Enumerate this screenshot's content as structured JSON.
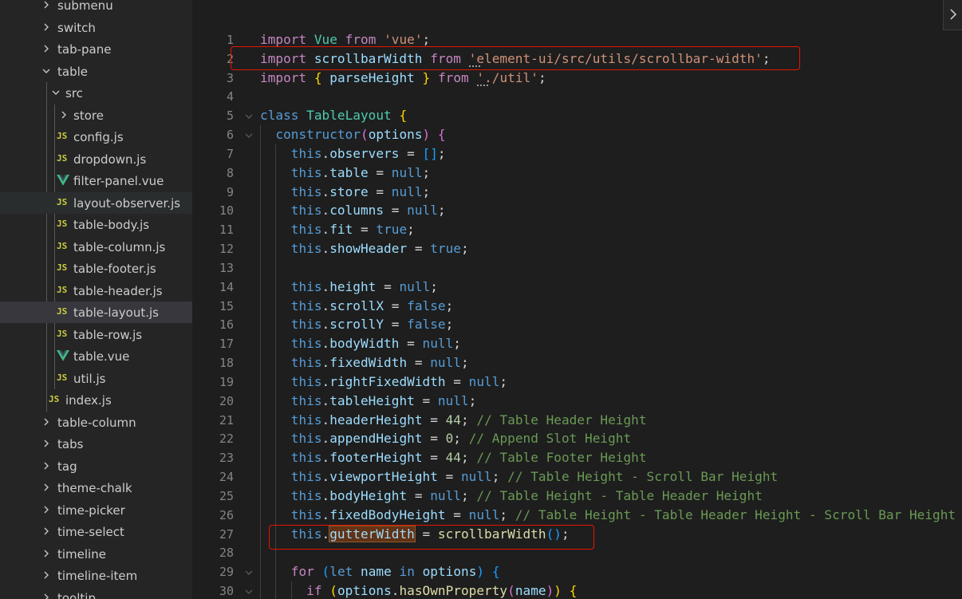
{
  "sidebar": {
    "items": [
      {
        "label": "submenu",
        "type": "folder",
        "open": false,
        "level": 1
      },
      {
        "label": "switch",
        "type": "folder",
        "open": false,
        "level": 1
      },
      {
        "label": "tab-pane",
        "type": "folder",
        "open": false,
        "level": 1
      },
      {
        "label": "table",
        "type": "folder",
        "open": true,
        "level": 1
      },
      {
        "label": "src",
        "type": "folder",
        "open": true,
        "level": 2
      },
      {
        "label": "store",
        "type": "folder",
        "open": false,
        "level": 3
      },
      {
        "label": "config.js",
        "type": "js",
        "level": 3
      },
      {
        "label": "dropdown.js",
        "type": "js",
        "level": 3
      },
      {
        "label": "filter-panel.vue",
        "type": "vue",
        "level": 3
      },
      {
        "label": "layout-observer.js",
        "type": "js",
        "level": 3,
        "state": "hover"
      },
      {
        "label": "table-body.js",
        "type": "js",
        "level": 3
      },
      {
        "label": "table-column.js",
        "type": "js",
        "level": 3
      },
      {
        "label": "table-footer.js",
        "type": "js",
        "level": 3
      },
      {
        "label": "table-header.js",
        "type": "js",
        "level": 3
      },
      {
        "label": "table-layout.js",
        "type": "js",
        "level": 3,
        "state": "selected"
      },
      {
        "label": "table-row.js",
        "type": "js",
        "level": 3
      },
      {
        "label": "table.vue",
        "type": "vue",
        "level": 3
      },
      {
        "label": "util.js",
        "type": "js",
        "level": 3
      },
      {
        "label": "index.js",
        "type": "js",
        "level": 2
      },
      {
        "label": "table-column",
        "type": "folder",
        "open": false,
        "level": 1
      },
      {
        "label": "tabs",
        "type": "folder",
        "open": false,
        "level": 1
      },
      {
        "label": "tag",
        "type": "folder",
        "open": false,
        "level": 1
      },
      {
        "label": "theme-chalk",
        "type": "folder",
        "open": false,
        "level": 1
      },
      {
        "label": "time-picker",
        "type": "folder",
        "open": false,
        "level": 1
      },
      {
        "label": "time-select",
        "type": "folder",
        "open": false,
        "level": 1
      },
      {
        "label": "timeline",
        "type": "folder",
        "open": false,
        "level": 1
      },
      {
        "label": "timeline-item",
        "type": "folder",
        "open": false,
        "level": 1
      },
      {
        "label": "tooltip",
        "type": "folder",
        "open": false,
        "level": 1
      }
    ],
    "js_badge": "JS"
  },
  "editor": {
    "lines": [
      {
        "n": "1",
        "indent": 0,
        "tokens": [
          [
            "kw",
            "import"
          ],
          [
            "p",
            " "
          ],
          [
            "cls",
            "Vue"
          ],
          [
            "p",
            " "
          ],
          [
            "kw",
            "from"
          ],
          [
            "p",
            " "
          ],
          [
            "str",
            "'vue'"
          ],
          [
            "p",
            ";"
          ]
        ]
      },
      {
        "n": "2",
        "indent": 0,
        "tokens": [
          [
            "kw",
            "import"
          ],
          [
            "p",
            " "
          ],
          [
            "id",
            "scrollbarWidth"
          ],
          [
            "p",
            " "
          ],
          [
            "kw",
            "from"
          ],
          [
            "p",
            " "
          ],
          [
            "str",
            "'element-ui/src/utils/scrollbar-width'"
          ],
          [
            "p",
            ";"
          ]
        ]
      },
      {
        "n": "3",
        "indent": 0,
        "tokens": [
          [
            "kw",
            "import"
          ],
          [
            "p",
            " "
          ],
          [
            "br1",
            "{"
          ],
          [
            "p",
            " "
          ],
          [
            "id",
            "parseHeight"
          ],
          [
            "p",
            " "
          ],
          [
            "br1",
            "}"
          ],
          [
            "p",
            " "
          ],
          [
            "kw",
            "from"
          ],
          [
            "p",
            " "
          ],
          [
            "str",
            "'./util'"
          ],
          [
            "p",
            ";"
          ]
        ]
      },
      {
        "n": "4",
        "indent": 0,
        "tokens": []
      },
      {
        "n": "5",
        "indent": 0,
        "fold": true,
        "tokens": [
          [
            "kb",
            "class"
          ],
          [
            "p",
            " "
          ],
          [
            "cls",
            "TableLayout"
          ],
          [
            "p",
            " "
          ],
          [
            "br1",
            "{"
          ]
        ]
      },
      {
        "n": "6",
        "indent": 1,
        "fold": true,
        "tokens": [
          [
            "kb",
            "constructor"
          ],
          [
            "br2",
            "("
          ],
          [
            "id",
            "options"
          ],
          [
            "br2",
            ")"
          ],
          [
            "p",
            " "
          ],
          [
            "br2",
            "{"
          ]
        ]
      },
      {
        "n": "7",
        "indent": 2,
        "tokens": [
          [
            "kb",
            "this"
          ],
          [
            "p",
            "."
          ],
          [
            "id",
            "observers"
          ],
          [
            "p",
            " = "
          ],
          [
            "br3",
            "[]"
          ],
          [
            "p",
            ";"
          ]
        ]
      },
      {
        "n": "8",
        "indent": 2,
        "tokens": [
          [
            "kb",
            "this"
          ],
          [
            "p",
            "."
          ],
          [
            "id",
            "table"
          ],
          [
            "p",
            " = "
          ],
          [
            "kb",
            "null"
          ],
          [
            "p",
            ";"
          ]
        ]
      },
      {
        "n": "9",
        "indent": 2,
        "tokens": [
          [
            "kb",
            "this"
          ],
          [
            "p",
            "."
          ],
          [
            "id",
            "store"
          ],
          [
            "p",
            " = "
          ],
          [
            "kb",
            "null"
          ],
          [
            "p",
            ";"
          ]
        ]
      },
      {
        "n": "10",
        "indent": 2,
        "tokens": [
          [
            "kb",
            "this"
          ],
          [
            "p",
            "."
          ],
          [
            "id",
            "columns"
          ],
          [
            "p",
            " = "
          ],
          [
            "kb",
            "null"
          ],
          [
            "p",
            ";"
          ]
        ]
      },
      {
        "n": "11",
        "indent": 2,
        "tokens": [
          [
            "kb",
            "this"
          ],
          [
            "p",
            "."
          ],
          [
            "id",
            "fit"
          ],
          [
            "p",
            " = "
          ],
          [
            "kb",
            "true"
          ],
          [
            "p",
            ";"
          ]
        ]
      },
      {
        "n": "12",
        "indent": 2,
        "tokens": [
          [
            "kb",
            "this"
          ],
          [
            "p",
            "."
          ],
          [
            "id",
            "showHeader"
          ],
          [
            "p",
            " = "
          ],
          [
            "kb",
            "true"
          ],
          [
            "p",
            ";"
          ]
        ]
      },
      {
        "n": "13",
        "indent": 2,
        "tokens": []
      },
      {
        "n": "14",
        "indent": 2,
        "tokens": [
          [
            "kb",
            "this"
          ],
          [
            "p",
            "."
          ],
          [
            "id",
            "height"
          ],
          [
            "p",
            " = "
          ],
          [
            "kb",
            "null"
          ],
          [
            "p",
            ";"
          ]
        ]
      },
      {
        "n": "15",
        "indent": 2,
        "tokens": [
          [
            "kb",
            "this"
          ],
          [
            "p",
            "."
          ],
          [
            "id",
            "scrollX"
          ],
          [
            "p",
            " = "
          ],
          [
            "kb",
            "false"
          ],
          [
            "p",
            ";"
          ]
        ]
      },
      {
        "n": "16",
        "indent": 2,
        "tokens": [
          [
            "kb",
            "this"
          ],
          [
            "p",
            "."
          ],
          [
            "id",
            "scrollY"
          ],
          [
            "p",
            " = "
          ],
          [
            "kb",
            "false"
          ],
          [
            "p",
            ";"
          ]
        ]
      },
      {
        "n": "17",
        "indent": 2,
        "tokens": [
          [
            "kb",
            "this"
          ],
          [
            "p",
            "."
          ],
          [
            "id",
            "bodyWidth"
          ],
          [
            "p",
            " = "
          ],
          [
            "kb",
            "null"
          ],
          [
            "p",
            ";"
          ]
        ]
      },
      {
        "n": "18",
        "indent": 2,
        "tokens": [
          [
            "kb",
            "this"
          ],
          [
            "p",
            "."
          ],
          [
            "id",
            "fixedWidth"
          ],
          [
            "p",
            " = "
          ],
          [
            "kb",
            "null"
          ],
          [
            "p",
            ";"
          ]
        ]
      },
      {
        "n": "19",
        "indent": 2,
        "tokens": [
          [
            "kb",
            "this"
          ],
          [
            "p",
            "."
          ],
          [
            "id",
            "rightFixedWidth"
          ],
          [
            "p",
            " = "
          ],
          [
            "kb",
            "null"
          ],
          [
            "p",
            ";"
          ]
        ]
      },
      {
        "n": "20",
        "indent": 2,
        "tokens": [
          [
            "kb",
            "this"
          ],
          [
            "p",
            "."
          ],
          [
            "id",
            "tableHeight"
          ],
          [
            "p",
            " = "
          ],
          [
            "kb",
            "null"
          ],
          [
            "p",
            ";"
          ]
        ]
      },
      {
        "n": "21",
        "indent": 2,
        "tokens": [
          [
            "kb",
            "this"
          ],
          [
            "p",
            "."
          ],
          [
            "id",
            "headerHeight"
          ],
          [
            "p",
            " = "
          ],
          [
            "num",
            "44"
          ],
          [
            "p",
            "; "
          ],
          [
            "cmt",
            "// Table Header Height"
          ]
        ]
      },
      {
        "n": "22",
        "indent": 2,
        "tokens": [
          [
            "kb",
            "this"
          ],
          [
            "p",
            "."
          ],
          [
            "id",
            "appendHeight"
          ],
          [
            "p",
            " = "
          ],
          [
            "num",
            "0"
          ],
          [
            "p",
            "; "
          ],
          [
            "cmt",
            "// Append Slot Height"
          ]
        ]
      },
      {
        "n": "23",
        "indent": 2,
        "tokens": [
          [
            "kb",
            "this"
          ],
          [
            "p",
            "."
          ],
          [
            "id",
            "footerHeight"
          ],
          [
            "p",
            " = "
          ],
          [
            "num",
            "44"
          ],
          [
            "p",
            "; "
          ],
          [
            "cmt",
            "// Table Footer Height"
          ]
        ]
      },
      {
        "n": "24",
        "indent": 2,
        "tokens": [
          [
            "kb",
            "this"
          ],
          [
            "p",
            "."
          ],
          [
            "id",
            "viewportHeight"
          ],
          [
            "p",
            " = "
          ],
          [
            "kb",
            "null"
          ],
          [
            "p",
            "; "
          ],
          [
            "cmt",
            "// Table Height - Scroll Bar Height"
          ]
        ]
      },
      {
        "n": "25",
        "indent": 2,
        "tokens": [
          [
            "kb",
            "this"
          ],
          [
            "p",
            "."
          ],
          [
            "id",
            "bodyHeight"
          ],
          [
            "p",
            " = "
          ],
          [
            "kb",
            "null"
          ],
          [
            "p",
            "; "
          ],
          [
            "cmt",
            "// Table Height - Table Header Height"
          ]
        ]
      },
      {
        "n": "26",
        "indent": 2,
        "tokens": [
          [
            "kb",
            "this"
          ],
          [
            "p",
            "."
          ],
          [
            "id",
            "fixedBodyHeight"
          ],
          [
            "p",
            " = "
          ],
          [
            "kb",
            "null"
          ],
          [
            "p",
            "; "
          ],
          [
            "cmt",
            "// Table Height - Table Header Height - Scroll Bar Height"
          ]
        ]
      },
      {
        "n": "27",
        "indent": 2,
        "tokens": [
          [
            "kb",
            "this"
          ],
          [
            "p",
            "."
          ],
          [
            "idhl",
            "gutterWidth"
          ],
          [
            "p",
            " = "
          ],
          [
            "fn",
            "scrollbarWidth"
          ],
          [
            "br3",
            "()"
          ],
          [
            "p",
            ";"
          ]
        ]
      },
      {
        "n": "28",
        "indent": 2,
        "tokens": []
      },
      {
        "n": "29",
        "indent": 2,
        "fold": true,
        "tokens": [
          [
            "kw",
            "for"
          ],
          [
            "p",
            " "
          ],
          [
            "br3",
            "("
          ],
          [
            "kb",
            "let"
          ],
          [
            "p",
            " "
          ],
          [
            "id",
            "name"
          ],
          [
            "p",
            " "
          ],
          [
            "kb",
            "in"
          ],
          [
            "p",
            " "
          ],
          [
            "id",
            "options"
          ],
          [
            "br3",
            ")"
          ],
          [
            "p",
            " "
          ],
          [
            "br3",
            "{"
          ]
        ]
      },
      {
        "n": "30",
        "indent": 3,
        "fold": true,
        "tokens": [
          [
            "kw",
            "if"
          ],
          [
            "p",
            " "
          ],
          [
            "br1",
            "("
          ],
          [
            "id",
            "options"
          ],
          [
            "p",
            "."
          ],
          [
            "fn",
            "hasOwnProperty"
          ],
          [
            "br2",
            "("
          ],
          [
            "id",
            "name"
          ],
          [
            "br2",
            ")"
          ],
          [
            "br1",
            ")"
          ],
          [
            "p",
            " "
          ],
          [
            "br1",
            "{"
          ]
        ]
      }
    ]
  },
  "colors": {
    "editor_bg": "#1e1e1e",
    "sidebar_bg": "#252526",
    "annotation_box": "#e51400",
    "word_highlight": "#613214"
  },
  "icons": {
    "folder_chevron": "chevron-right-icon",
    "folder_open_chevron": "chevron-down-icon",
    "js_file": "js-file-icon",
    "vue_file": "vue-file-icon",
    "fold": "fold-chevron-icon",
    "expand_panel": "chevron-right-icon"
  }
}
